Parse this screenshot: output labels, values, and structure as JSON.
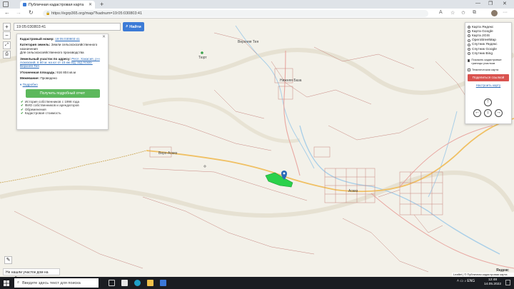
{
  "browser": {
    "tab_title": "Публичная кадастровая карта",
    "url": "https://egrp365.org/map/?kadnum=19:05:030803:41"
  },
  "search": {
    "value": "19:05:030803:41",
    "button_label": "Найти"
  },
  "info": {
    "cadastral_label": "Кадастровый номер:",
    "cadastral_value": "19:05:030803:41",
    "category_label": "Категория земель:",
    "category_value": "Земли сельскохозяйственного назначения",
    "use_value": "Для сельскохозяйственного производства",
    "address_label": "Земельный участок по адресу:",
    "address_value": "Респ. Хакасия, р-н Аскизский, в 50 м. на юг от 15 км а/д. а/д Аскиз-Верхняя Тея",
    "area_label": "Уточненная площадь:",
    "area_value": "916 804 кв.м",
    "boundary_label": "Межевание:",
    "boundary_value": "Проведено",
    "details_link": "Подробно",
    "report_button": "Получить подробный отчет",
    "report_items": [
      "История собственников с 1998 года",
      "ФИО собственников и арендаторов",
      "Обременения",
      "Кадастровая стоимость"
    ]
  },
  "layers": {
    "options": [
      "Карта Яндекс",
      "Карта Google",
      "Карта 2GIS",
      "OpenStreetMap",
      "Спутник Яндекс",
      "Спутник Google",
      "Спутник Bing"
    ],
    "selected_index": 0,
    "show_borders_label": "Показать кадастровые границы участков",
    "show_borders_checked": true,
    "thematic_label": "Тематическая карта",
    "thematic_checked": false,
    "share_button": "Поделиться ссылкой",
    "configure_link": "Настроить карту"
  },
  "map": {
    "places": [
      "Верхняя Тея",
      "Нижняя База",
      "Верх-Аскиз",
      "Аскиз",
      "Тюрт"
    ],
    "highlight_color": "#2bd14b",
    "marker_color": "#2a6ab8"
  },
  "bottom": {
    "not_found": "Не нашли участок дом на карте?",
    "attribution": "Leaflet | © Публичная кадастровая карта"
  },
  "taskbar": {
    "search_placeholder": "Введите здесь текст для поиска",
    "lang": "ENG",
    "time": "12:48",
    "date": "14.05.2022"
  }
}
